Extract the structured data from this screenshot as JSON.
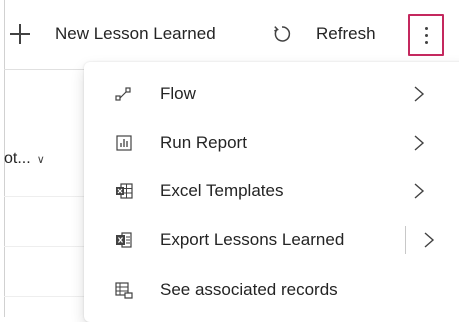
{
  "toolbar": {
    "new_label": "New Lesson Learned",
    "refresh_label": "Refresh",
    "more_icon": "more-vertical-icon",
    "highlight_color": "#c4285e"
  },
  "grid": {
    "column_header": "ot..."
  },
  "menu": {
    "items": [
      {
        "label": "Flow",
        "icon": "flow-icon",
        "has_submenu": true
      },
      {
        "label": "Run Report",
        "icon": "report-icon",
        "has_submenu": true
      },
      {
        "label": "Excel Templates",
        "icon": "excel-icon",
        "has_submenu": true
      },
      {
        "label": "Export Lessons Learned",
        "icon": "excel-export-icon",
        "has_submenu": true,
        "split": true
      },
      {
        "label": "See associated records",
        "icon": "associated-records-icon",
        "has_submenu": false
      }
    ]
  }
}
